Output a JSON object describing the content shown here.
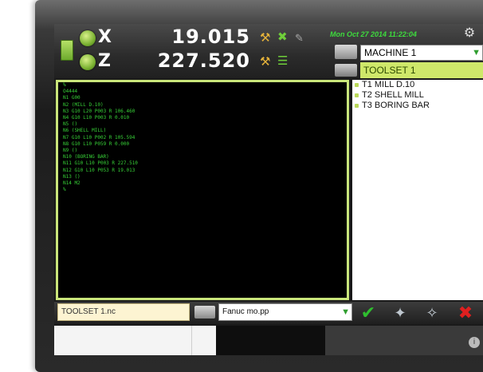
{
  "axes": [
    {
      "letter": "X",
      "value": "19.015"
    },
    {
      "letter": "Z",
      "value": "227.520"
    }
  ],
  "datetime": "Mon Oct 27 2014 11:22:04",
  "machine": {
    "selected": "MACHINE 1"
  },
  "toolset": {
    "header": "TOOLSET 1",
    "tools": [
      "T1 MILL D.10",
      "T2 SHELL MILL",
      "T3 BORING BAR"
    ]
  },
  "code_lines": [
    "%",
    "O4444",
    "N1 G00",
    "N2 (MILL D.10)",
    "N3 G10 L20 P003 R 106.460",
    "N4 G10 L10 P003 R 0.010",
    "N5 ()",
    "N6 (SHELL MILL)",
    "N7 G10 L10 P002 R 105.594",
    "N8 G10 L10 P059 R 0.000",
    "N9 ()",
    "N10 (BORING BAR)",
    "N11 G10 L10 P003 R 227.510",
    "N12 G10 L10 P053 R 19.013",
    "N13 ()",
    "N14 M2",
    "%"
  ],
  "bottom": {
    "filename": "TOOLSET 1.nc",
    "postprocessor": "Fanuc mo.pp"
  },
  "colors": {
    "accent_green": "#cfe86a",
    "code_green": "#37d237",
    "datetime_green": "#3ddc3d",
    "confirm": "#2fbf2f",
    "cancel": "#e02020"
  }
}
